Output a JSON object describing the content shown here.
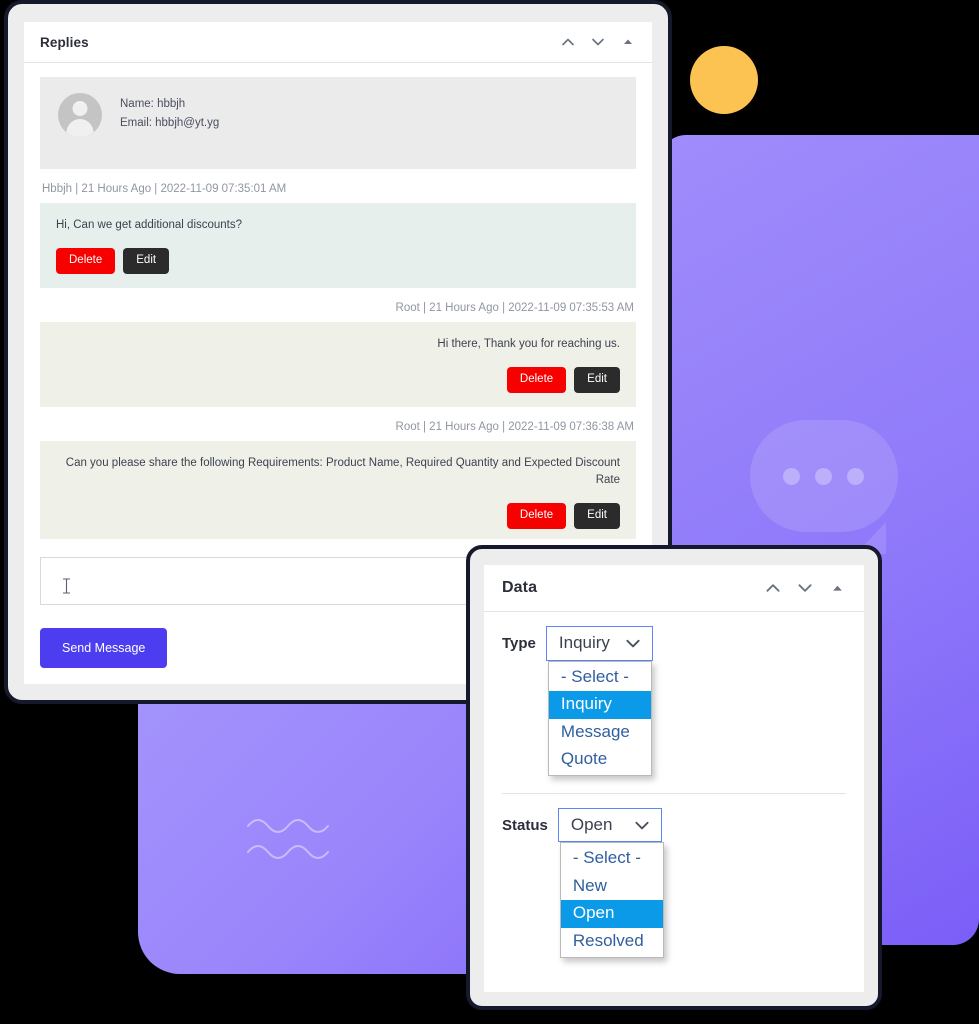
{
  "replies_window": {
    "header": {
      "title": "Replies",
      "icons": [
        {
          "name": "chevron-up-icon",
          "glyph": "chevron-up"
        },
        {
          "name": "chevron-down-icon",
          "glyph": "chevron-down"
        },
        {
          "name": "collapse-triangle-icon",
          "glyph": "triangle-up"
        }
      ]
    },
    "contact": {
      "name_line": "Name: hbbjh",
      "email_line": "Email: hbbjh@yt.yg"
    },
    "messages": [
      {
        "meta": "Hbbjh | 21 Hours Ago | 2022-11-09 07:35:01 AM",
        "text": "Hi, Can we get additional discounts?",
        "direction": "incoming",
        "delete_label": "Delete",
        "edit_label": "Edit"
      },
      {
        "meta": "Root | 21 Hours Ago | 2022-11-09 07:35:53 AM",
        "text": "Hi there, Thank you for reaching us.",
        "direction": "outgoing",
        "delete_label": "Delete",
        "edit_label": "Edit"
      },
      {
        "meta": "Root | 21 Hours Ago | 2022-11-09 07:36:38 AM",
        "text": "Can you please share the following Requirements: Product Name, Required Quantity and Expected Discount Rate",
        "direction": "outgoing",
        "delete_label": "Delete",
        "edit_label": "Edit"
      }
    ],
    "composer": {
      "value": "",
      "placeholder": "",
      "send_label": "Send Message"
    }
  },
  "data_window": {
    "header": {
      "title": "Data",
      "icons": [
        {
          "name": "chevron-up-icon",
          "glyph": "chevron-up"
        },
        {
          "name": "chevron-down-icon",
          "glyph": "chevron-down"
        },
        {
          "name": "collapse-triangle-icon",
          "glyph": "triangle-up"
        }
      ]
    },
    "fields": [
      {
        "label": "Type",
        "value": "Inquiry",
        "options": [
          "- Select -",
          "Inquiry",
          "Message",
          "Quote"
        ],
        "selected_index": 1,
        "open": true
      },
      {
        "label": "Status",
        "value": "Open",
        "options": [
          "- Select -",
          "New",
          "Open",
          "Resolved"
        ],
        "selected_index": 2,
        "open": true
      }
    ]
  },
  "decor": {
    "dot_color": "#fcc252",
    "card_purple_from": "#a08cfb",
    "card_purple_to": "#7b5ef8",
    "watermark": "speech-bubble",
    "waves": "wave-lines"
  },
  "colors": {
    "accent": "#4c3ef0",
    "danger": "#f70000",
    "dark": "#2b2b2b",
    "select_highlight": "#0a9ae8",
    "focus_border": "#5b86f5",
    "incoming_bubble": "#e6efec",
    "outgoing_bubble": "#eff0e8"
  }
}
